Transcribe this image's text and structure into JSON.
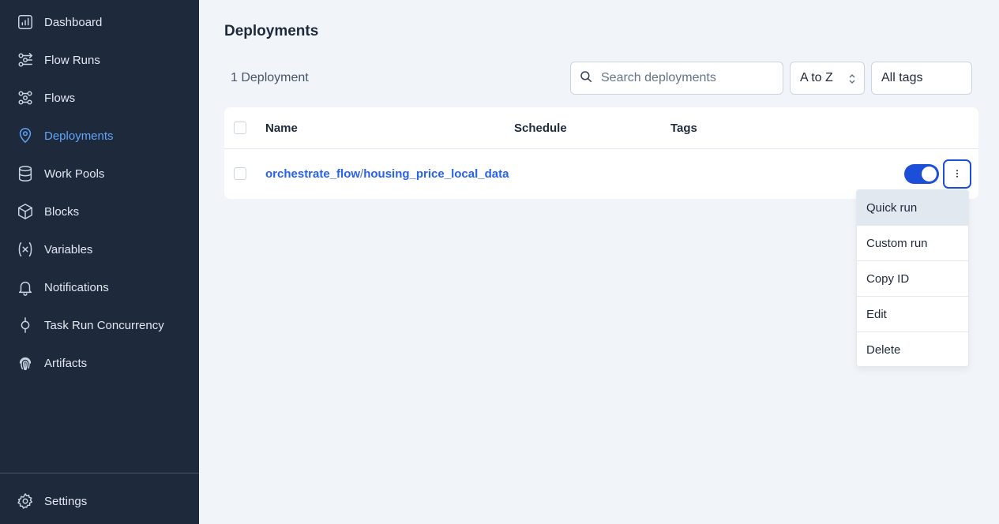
{
  "sidebar": {
    "items": [
      {
        "label": "Dashboard",
        "icon": "chart-bar-icon"
      },
      {
        "label": "Flow Runs",
        "icon": "flow-runs-icon"
      },
      {
        "label": "Flows",
        "icon": "flows-icon"
      },
      {
        "label": "Deployments",
        "icon": "map-pin-icon",
        "active": true
      },
      {
        "label": "Work Pools",
        "icon": "database-icon"
      },
      {
        "label": "Blocks",
        "icon": "cube-icon"
      },
      {
        "label": "Variables",
        "icon": "variable-icon"
      },
      {
        "label": "Notifications",
        "icon": "bell-icon"
      },
      {
        "label": "Task Run Concurrency",
        "icon": "concurrency-icon"
      },
      {
        "label": "Artifacts",
        "icon": "fingerprint-icon"
      }
    ],
    "settings": {
      "label": "Settings",
      "icon": "gear-icon"
    }
  },
  "page": {
    "title": "Deployments",
    "count_text": "1 Deployment"
  },
  "filters": {
    "search_placeholder": "Search deployments",
    "sort_value": "A to Z",
    "tags_value": "All tags"
  },
  "table": {
    "columns": [
      "Name",
      "Schedule",
      "Tags"
    ],
    "rows": [
      {
        "flow": "orchestrate_flow",
        "separator": "/",
        "deployment": "housing_price_local_data",
        "schedule": "",
        "tags": "",
        "enabled": true
      }
    ]
  },
  "menu": {
    "items": [
      "Quick run",
      "Custom run",
      "Copy ID",
      "Edit",
      "Delete"
    ],
    "highlighted": "Quick run"
  },
  "colors": {
    "sidebar_bg": "#1e293b",
    "accent": "#60a5fa",
    "link": "#2563eb",
    "toggle_on": "#1d4ed8",
    "page_bg": "#f1f5f9"
  }
}
